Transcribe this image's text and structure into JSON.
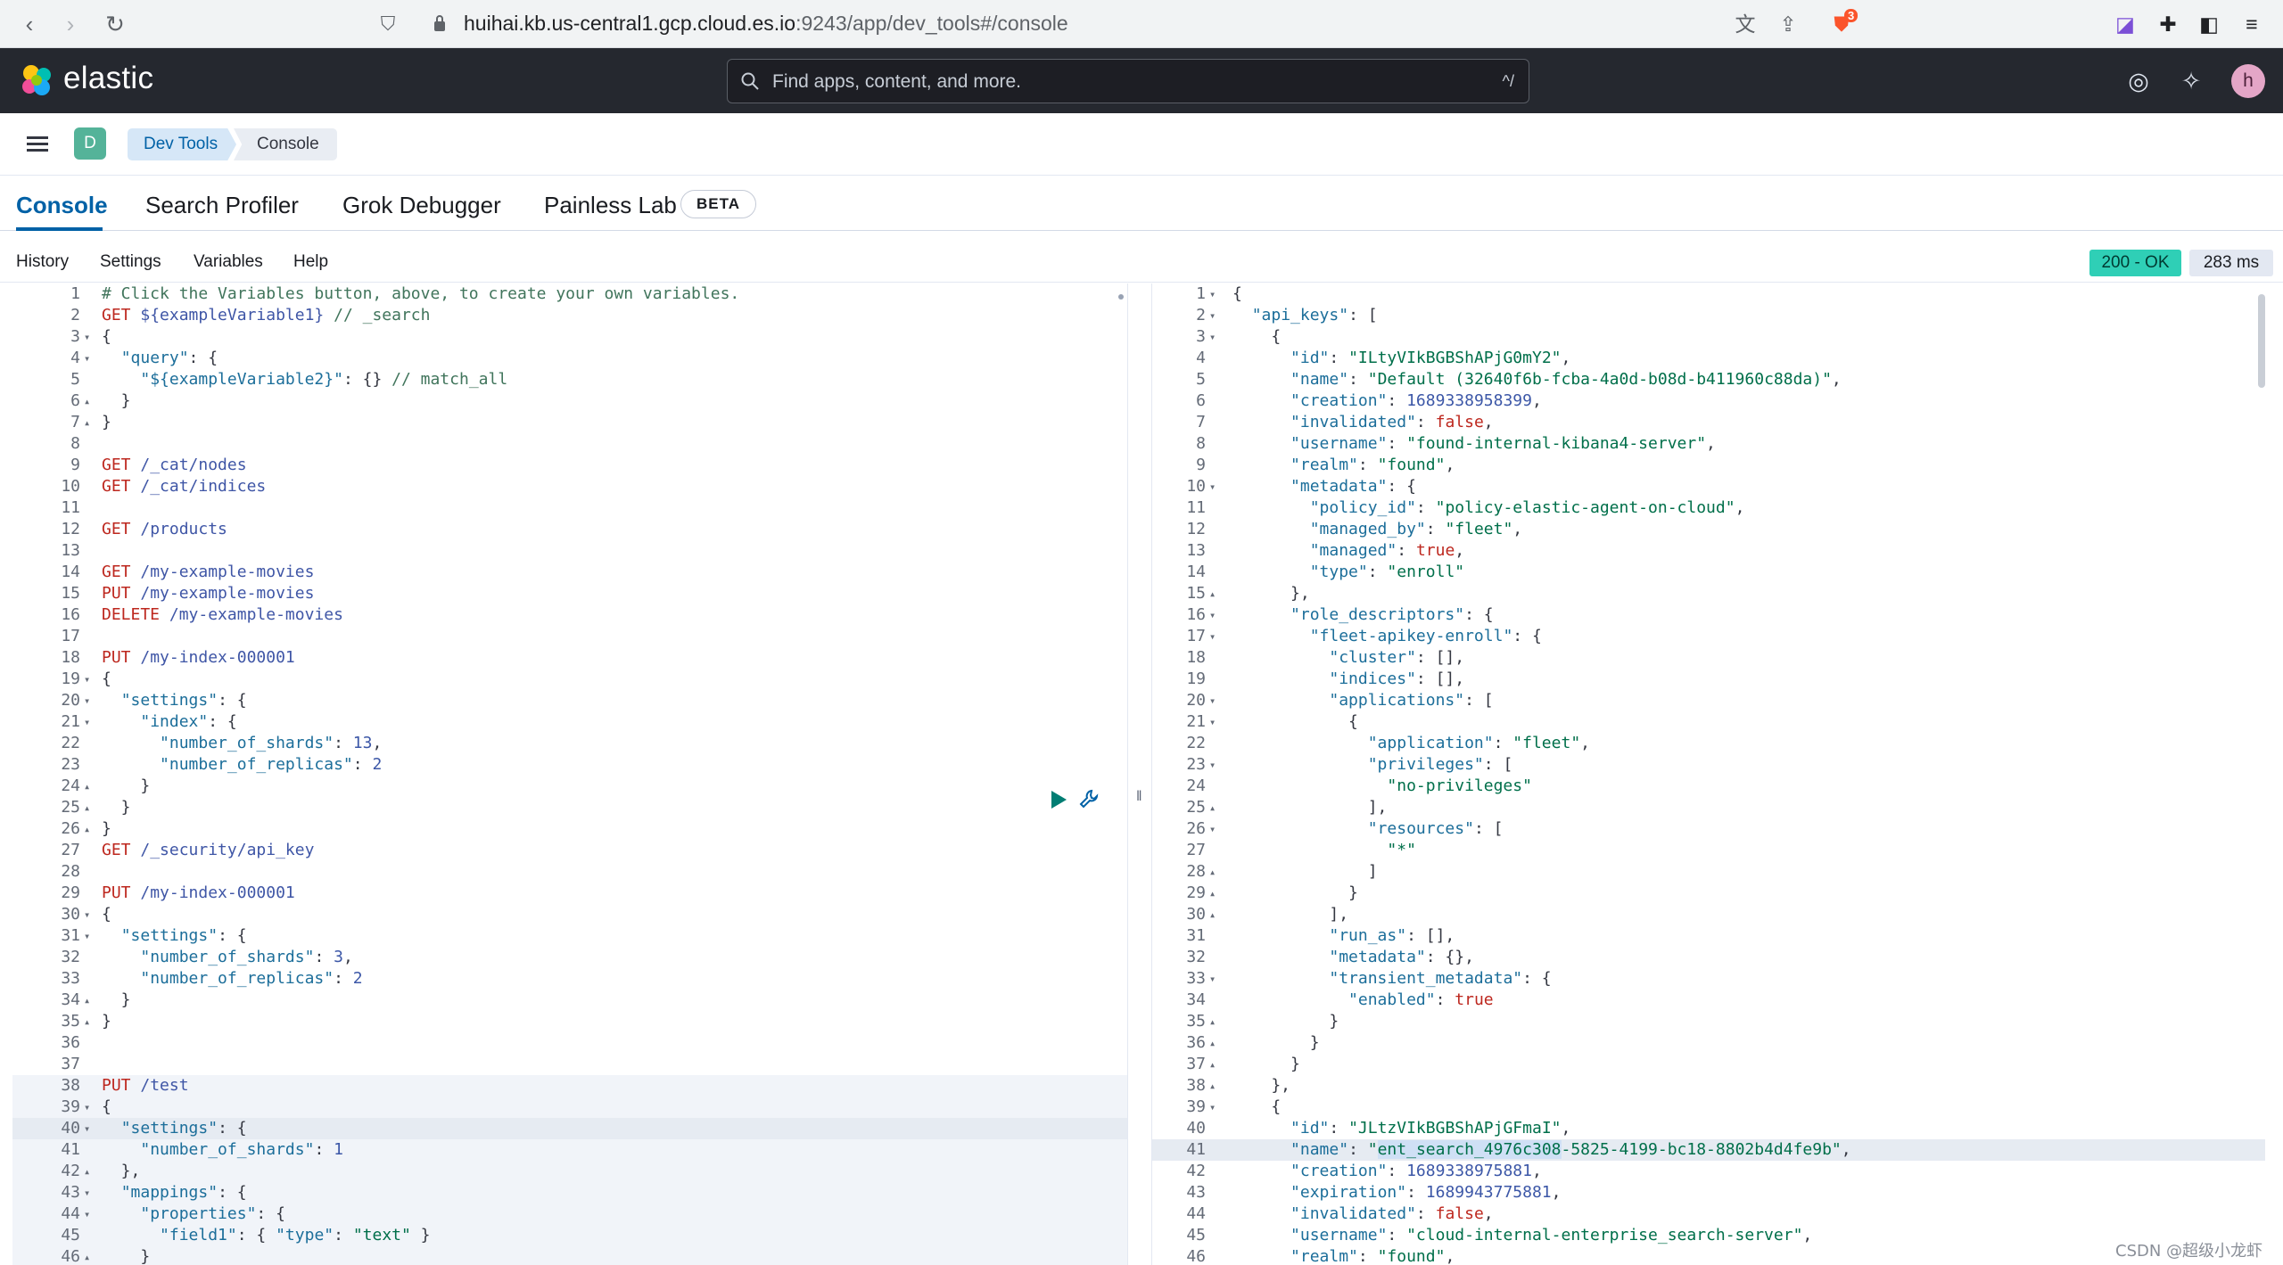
{
  "browser": {
    "url_host": "huihai.kb.us-central1.gcp.cloud.es.io",
    "url_path": ":9243/app/dev_tools#/console",
    "icons": [
      "back-icon",
      "forward-icon",
      "reload-icon",
      "bookmark-icon",
      "lock-icon",
      "translate-icon",
      "share-icon",
      "brave-shield-icon",
      "extension-icon",
      "puzzle-icon",
      "sidebar-icon",
      "more-icon"
    ],
    "shield_count": "3"
  },
  "header": {
    "logo_text": "elastic",
    "search_placeholder": "Find apps, content, and more.",
    "search_shortcut": "^/",
    "avatar_initial": "h"
  },
  "breadcrumb": {
    "space_initial": "D",
    "items": [
      "Dev Tools",
      "Console"
    ]
  },
  "tabs": [
    "Console",
    "Search Profiler",
    "Grok Debugger",
    "Painless Lab"
  ],
  "beta_label": "BETA",
  "toolbar": {
    "items": [
      "History",
      "Settings",
      "Variables",
      "Help"
    ],
    "status": "200 - OK",
    "time": "283 ms"
  },
  "colors": {
    "header_bg": "#25282f",
    "accent": "#0061a6",
    "status_ok": "#2fcfb6"
  },
  "request_editor": {
    "lines": [
      {
        "n": "1",
        "fold": "",
        "t": "# Click the Variables button, above, to create your own variables."
      },
      {
        "n": "2",
        "fold": "",
        "t": "GET ${exampleVariable1} // _search"
      },
      {
        "n": "3",
        "fold": "▾",
        "t": "{"
      },
      {
        "n": "4",
        "fold": "▾",
        "t": "  \"query\": {"
      },
      {
        "n": "5",
        "fold": "",
        "t": "    \"${exampleVariable2}\": {} // match_all"
      },
      {
        "n": "6",
        "fold": "▴",
        "t": "  }"
      },
      {
        "n": "7",
        "fold": "▴",
        "t": "}"
      },
      {
        "n": "8",
        "fold": "",
        "t": ""
      },
      {
        "n": "9",
        "fold": "",
        "t": "GET /_cat/nodes"
      },
      {
        "n": "10",
        "fold": "",
        "t": "GET /_cat/indices"
      },
      {
        "n": "11",
        "fold": "",
        "t": ""
      },
      {
        "n": "12",
        "fold": "",
        "t": "GET /products"
      },
      {
        "n": "13",
        "fold": "",
        "t": ""
      },
      {
        "n": "14",
        "fold": "",
        "t": "GET /my-example-movies"
      },
      {
        "n": "15",
        "fold": "",
        "t": "PUT /my-example-movies"
      },
      {
        "n": "16",
        "fold": "",
        "t": "DELETE /my-example-movies"
      },
      {
        "n": "17",
        "fold": "",
        "t": ""
      },
      {
        "n": "18",
        "fold": "",
        "t": "PUT /my-index-000001"
      },
      {
        "n": "19",
        "fold": "▾",
        "t": "{"
      },
      {
        "n": "20",
        "fold": "▾",
        "t": "  \"settings\": {"
      },
      {
        "n": "21",
        "fold": "▾",
        "t": "    \"index\": {"
      },
      {
        "n": "22",
        "fold": "",
        "t": "      \"number_of_shards\": 13,"
      },
      {
        "n": "23",
        "fold": "",
        "t": "      \"number_of_replicas\": 2"
      },
      {
        "n": "24",
        "fold": "▴",
        "t": "    }"
      },
      {
        "n": "25",
        "fold": "▴",
        "t": "  }"
      },
      {
        "n": "26",
        "fold": "▴",
        "t": "}"
      },
      {
        "n": "27",
        "fold": "",
        "t": "GET /_security/api_key"
      },
      {
        "n": "28",
        "fold": "",
        "t": ""
      },
      {
        "n": "29",
        "fold": "",
        "t": "PUT /my-index-000001"
      },
      {
        "n": "30",
        "fold": "▾",
        "t": "{"
      },
      {
        "n": "31",
        "fold": "▾",
        "t": "  \"settings\": {"
      },
      {
        "n": "32",
        "fold": "",
        "t": "    \"number_of_shards\": 3,"
      },
      {
        "n": "33",
        "fold": "",
        "t": "    \"number_of_replicas\": 2"
      },
      {
        "n": "34",
        "fold": "▴",
        "t": "  }"
      },
      {
        "n": "35",
        "fold": "▴",
        "t": "}"
      },
      {
        "n": "36",
        "fold": "",
        "t": ""
      },
      {
        "n": "37",
        "fold": "",
        "t": ""
      },
      {
        "n": "38",
        "fold": "",
        "t": "PUT /test"
      },
      {
        "n": "39",
        "fold": "▾",
        "t": "{"
      },
      {
        "n": "40",
        "fold": "▾",
        "t": "  \"settings\": {"
      },
      {
        "n": "41",
        "fold": "",
        "t": "    \"number_of_shards\": 1"
      },
      {
        "n": "42",
        "fold": "▴",
        "t": "  },"
      },
      {
        "n": "43",
        "fold": "▾",
        "t": "  \"mappings\": {"
      },
      {
        "n": "44",
        "fold": "▾",
        "t": "    \"properties\": {"
      },
      {
        "n": "45",
        "fold": "",
        "t": "      \"field1\": { \"type\": \"text\" }"
      },
      {
        "n": "46",
        "fold": "▴",
        "t": "    }"
      }
    ]
  },
  "response_editor": {
    "lines": [
      {
        "n": "1",
        "fold": "▾",
        "t": "{"
      },
      {
        "n": "2",
        "fold": "▾",
        "t": "  \"api_keys\": ["
      },
      {
        "n": "3",
        "fold": "▾",
        "t": "    {"
      },
      {
        "n": "4",
        "fold": "",
        "t": "      \"id\": \"ILtyVIkBGBShAPjG0mY2\","
      },
      {
        "n": "5",
        "fold": "",
        "t": "      \"name\": \"Default (32640f6b-fcba-4a0d-b08d-b411960c88da)\","
      },
      {
        "n": "6",
        "fold": "",
        "t": "      \"creation\": 1689338958399,"
      },
      {
        "n": "7",
        "fold": "",
        "t": "      \"invalidated\": false,"
      },
      {
        "n": "8",
        "fold": "",
        "t": "      \"username\": \"found-internal-kibana4-server\","
      },
      {
        "n": "9",
        "fold": "",
        "t": "      \"realm\": \"found\","
      },
      {
        "n": "10",
        "fold": "▾",
        "t": "      \"metadata\": {"
      },
      {
        "n": "11",
        "fold": "",
        "t": "        \"policy_id\": \"policy-elastic-agent-on-cloud\","
      },
      {
        "n": "12",
        "fold": "",
        "t": "        \"managed_by\": \"fleet\","
      },
      {
        "n": "13",
        "fold": "",
        "t": "        \"managed\": true,"
      },
      {
        "n": "14",
        "fold": "",
        "t": "        \"type\": \"enroll\""
      },
      {
        "n": "15",
        "fold": "▴",
        "t": "      },"
      },
      {
        "n": "16",
        "fold": "▾",
        "t": "      \"role_descriptors\": {"
      },
      {
        "n": "17",
        "fold": "▾",
        "t": "        \"fleet-apikey-enroll\": {"
      },
      {
        "n": "18",
        "fold": "",
        "t": "          \"cluster\": [],"
      },
      {
        "n": "19",
        "fold": "",
        "t": "          \"indices\": [],"
      },
      {
        "n": "20",
        "fold": "▾",
        "t": "          \"applications\": ["
      },
      {
        "n": "21",
        "fold": "▾",
        "t": "            {"
      },
      {
        "n": "22",
        "fold": "",
        "t": "              \"application\": \"fleet\","
      },
      {
        "n": "23",
        "fold": "▾",
        "t": "              \"privileges\": ["
      },
      {
        "n": "24",
        "fold": "",
        "t": "                \"no-privileges\""
      },
      {
        "n": "25",
        "fold": "▴",
        "t": "              ],"
      },
      {
        "n": "26",
        "fold": "▾",
        "t": "              \"resources\": ["
      },
      {
        "n": "27",
        "fold": "",
        "t": "                \"*\""
      },
      {
        "n": "28",
        "fold": "▴",
        "t": "              ]"
      },
      {
        "n": "29",
        "fold": "▴",
        "t": "            }"
      },
      {
        "n": "30",
        "fold": "▴",
        "t": "          ],"
      },
      {
        "n": "31",
        "fold": "",
        "t": "          \"run_as\": [],"
      },
      {
        "n": "32",
        "fold": "",
        "t": "          \"metadata\": {},"
      },
      {
        "n": "33",
        "fold": "▾",
        "t": "          \"transient_metadata\": {"
      },
      {
        "n": "34",
        "fold": "",
        "t": "            \"enabled\": true"
      },
      {
        "n": "35",
        "fold": "▴",
        "t": "          }"
      },
      {
        "n": "36",
        "fold": "▴",
        "t": "        }"
      },
      {
        "n": "37",
        "fold": "▴",
        "t": "      }"
      },
      {
        "n": "38",
        "fold": "▴",
        "t": "    },"
      },
      {
        "n": "39",
        "fold": "▾",
        "t": "    {"
      },
      {
        "n": "40",
        "fold": "",
        "t": "      \"id\": \"JLtzVIkBGBShAPjGFmaI\","
      },
      {
        "n": "41",
        "fold": "",
        "t": "      \"name\": \"ent_search_4976c308-5825-4199-bc18-8802b4d4fe9b\","
      },
      {
        "n": "42",
        "fold": "",
        "t": "      \"creation\": 1689338975881,"
      },
      {
        "n": "43",
        "fold": "",
        "t": "      \"expiration\": 1689943775881,"
      },
      {
        "n": "44",
        "fold": "",
        "t": "      \"invalidated\": false,"
      },
      {
        "n": "45",
        "fold": "",
        "t": "      \"username\": \"cloud-internal-enterprise_search-server\","
      },
      {
        "n": "46",
        "fold": "",
        "t": "      \"realm\": \"found\","
      }
    ]
  },
  "watermark": "CSDN @超级小龙虾"
}
